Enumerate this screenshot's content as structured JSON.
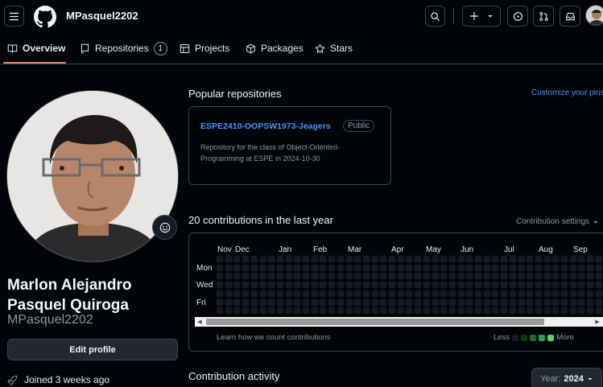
{
  "header": {
    "username": "MPasquel2202",
    "icons": [
      "hamburger-icon",
      "github-logo",
      "search-icon",
      "plus-icon",
      "chevron-down-icon",
      "issues-icon",
      "pull-request-icon",
      "inbox-icon"
    ]
  },
  "tabs": [
    {
      "label": "Overview",
      "icon": "book-icon",
      "active": true
    },
    {
      "label": "Repositories",
      "icon": "repo-icon",
      "count": "1"
    },
    {
      "label": "Projects",
      "icon": "table-icon"
    },
    {
      "label": "Packages",
      "icon": "package-icon"
    },
    {
      "label": "Stars",
      "icon": "star-icon"
    }
  ],
  "profile": {
    "full_name": "Marlon Alejandro Pasquel Quiroga",
    "login": "MPasquel2202",
    "edit_label": "Edit profile",
    "joined": "Joined 3 weeks ago"
  },
  "popular": {
    "title": "Popular repositories",
    "customize": "Customize your pins",
    "repo": {
      "name": "ESPE2410-OOPSW1973-Jeagers",
      "visibility": "Public",
      "description": "Repository for the class of Object-Oriented-Programming at ESPE in 2024-10-30"
    }
  },
  "contributions": {
    "title": "20 contributions in the last year",
    "settings": "Contribution settings",
    "months": [
      "Nov",
      "Dec",
      "Jan",
      "Feb",
      "Mar",
      "Apr",
      "May",
      "Jun",
      "Jul",
      "Aug",
      "Sep"
    ],
    "days": [
      "Mon",
      "Wed",
      "Fri"
    ],
    "learn": "Learn how we count contributions",
    "less": "Less",
    "more": "More",
    "levels": [
      "#151b23",
      "#033a16",
      "#196c2e",
      "#2ea043",
      "#56d364"
    ]
  },
  "activity": {
    "title": "Contribution activity",
    "year_label": "Year:",
    "year": "2024"
  },
  "colors": {
    "accent": "#f78166",
    "link": "#4493f8",
    "bg": "#010409",
    "border": "#3d444d"
  }
}
